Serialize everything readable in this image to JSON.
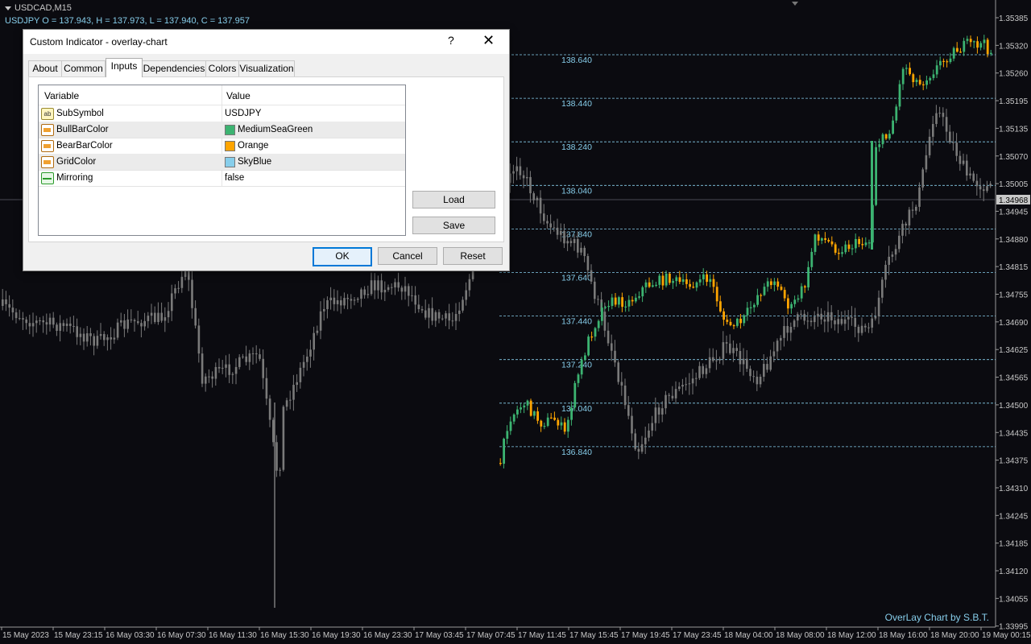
{
  "chart": {
    "title": "USDCAD,M15",
    "ohlc": "USDJPY O = 137.943, H = 137.973, L = 137.940, C = 137.957",
    "watermark": "OverLay Chart by S.B.T.",
    "price_axis": [
      "1.35385",
      "1.35320",
      "1.35260",
      "1.35195",
      "1.35135",
      "1.35070",
      "1.35005",
      "1.34945",
      "1.34880",
      "1.34815",
      "1.34755",
      "1.34690",
      "1.34625",
      "1.34565",
      "1.34500",
      "1.34435",
      "1.34375",
      "1.34310",
      "1.34245",
      "1.34185",
      "1.34120",
      "1.34055",
      "1.33995"
    ],
    "current_price": "1.34968",
    "overlay_grid_labels": [
      "138.640",
      "138.440",
      "138.240",
      "138.040",
      "137.840",
      "137.640",
      "137.440",
      "137.240",
      "137.040",
      "136.840"
    ],
    "time_axis": [
      "15 May 2023",
      "15 May 23:15",
      "16 May 03:30",
      "16 May 07:30",
      "16 May 11:30",
      "16 May 15:30",
      "16 May 19:30",
      "16 May 23:30",
      "17 May 03:45",
      "17 May 07:45",
      "17 May 11:45",
      "17 May 15:45",
      "17 May 19:45",
      "17 May 23:45",
      "18 May 04:00",
      "18 May 08:00",
      "18 May 12:00",
      "18 May 16:00",
      "18 May 20:00",
      "19 May 00:15"
    ],
    "colors": {
      "background": "#0b0b10",
      "main_candles": "#7a7a7a",
      "bull": "#3cb371",
      "bear": "#ffa500",
      "grid": "#87ceeb",
      "text": "#c8c8c8"
    }
  },
  "dialog": {
    "title": "Custom Indicator - overlay-chart",
    "help": "?",
    "close": "✕",
    "tabs": [
      "About",
      "Common",
      "Inputs",
      "Dependencies",
      "Colors",
      "Visualization"
    ],
    "active_tab": "Inputs",
    "columns": {
      "variable": "Variable",
      "value": "Value"
    },
    "inputs": [
      {
        "name": "SubSymbol",
        "value": "USDJPY",
        "icon": "ab-icon"
      },
      {
        "name": "BullBarColor",
        "value": "MediumSeaGreen",
        "swatch": "#3cb371",
        "icon": "color-icon"
      },
      {
        "name": "BearBarColor",
        "value": "Orange",
        "swatch": "#ffa500",
        "icon": "color-icon"
      },
      {
        "name": "GridColor",
        "value": "SkyBlue",
        "swatch": "#87ceeb",
        "icon": "color-icon"
      },
      {
        "name": "Mirroring",
        "value": "false",
        "icon": "bool-icon"
      }
    ],
    "buttons": {
      "load": "Load",
      "save": "Save",
      "ok": "OK",
      "cancel": "Cancel",
      "reset": "Reset"
    }
  }
}
